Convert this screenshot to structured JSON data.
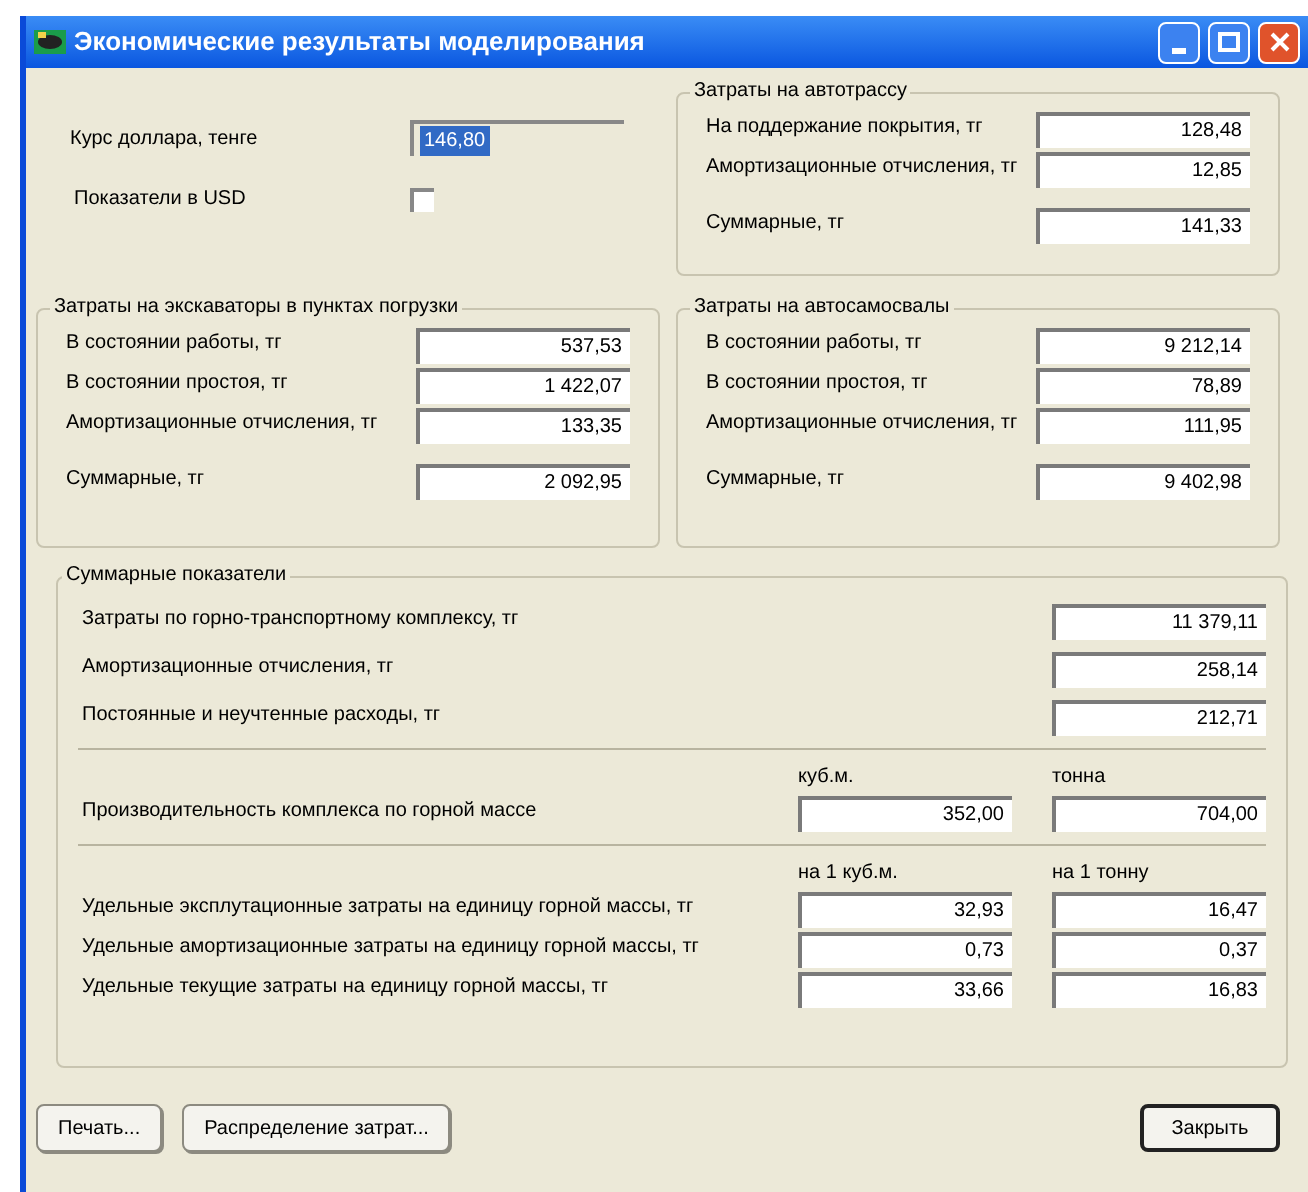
{
  "window": {
    "title": "Экономические результаты моделирования"
  },
  "exchange_rate": {
    "label": "Курс доллара, тенге",
    "value": "146,80",
    "selected": true
  },
  "usd": {
    "label": "Показатели в USD",
    "checked": false
  },
  "road": {
    "title": "Затраты на автотрассу",
    "rows": [
      {
        "label": "На поддержание покрытия, тг",
        "value": "128,48"
      },
      {
        "label": "Амортизационные отчисления, тг",
        "value": "12,85"
      }
    ],
    "total": {
      "label": "Суммарные, тг",
      "value": "141,33"
    }
  },
  "groups": [
    {
      "title": "Затраты на экскаваторы в пунктах погрузки",
      "rows": [
        {
          "label": "В состоянии работы, тг",
          "value": "537,53"
        },
        {
          "label": "В состоянии простоя, тг",
          "value": "1 422,07"
        },
        {
          "label": "Амортизационные отчисления, тг",
          "value": "133,35"
        }
      ],
      "total": {
        "label": "Суммарные, тг",
        "value": "2 092,95"
      }
    },
    {
      "title": "Затраты на автосамосвалы",
      "rows": [
        {
          "label": "В состоянии работы, тг",
          "value": "9 212,14"
        },
        {
          "label": "В состоянии простоя, тг",
          "value": "78,89"
        },
        {
          "label": "Амортизационные отчисления, тг",
          "value": "111,95"
        }
      ],
      "total": {
        "label": "Суммарные, тг",
        "value": "9 402,98"
      }
    }
  ],
  "summary": {
    "title": "Суммарные показатели",
    "rows": [
      {
        "label": "Затраты по горно-транспортному комплексу, тг",
        "value": "11 379,11"
      },
      {
        "label": "Амортизационные отчисления, тг",
        "value": "258,14"
      },
      {
        "label": "Постоянные и неучтенные расходы, тг",
        "value": "212,71"
      }
    ],
    "productivity": {
      "columns": [
        "куб.м.",
        "тонна"
      ],
      "label": "Производительность комплекса по горной массе",
      "values": [
        "352,00",
        "704,00"
      ]
    },
    "unit_costs": {
      "columns": [
        "на 1 куб.м.",
        "на 1 тонну"
      ],
      "rows": [
        {
          "label": "Удельные эксплутационные затраты на единицу горной массы, тг",
          "values": [
            "32,93",
            "16,47"
          ]
        },
        {
          "label": "Удельные амортизационные затраты на единицу горной массы, тг",
          "values": [
            "0,73",
            "0,37"
          ]
        },
        {
          "label": "Удельные текущие затраты на единицу горной массы, тг",
          "values": [
            "33,66",
            "16,83"
          ]
        }
      ]
    }
  },
  "buttons": [
    {
      "label": "Печать...",
      "default": false
    },
    {
      "label": "Распределение затрат...",
      "default": false
    },
    {
      "label": "Закрыть",
      "default": true
    }
  ]
}
